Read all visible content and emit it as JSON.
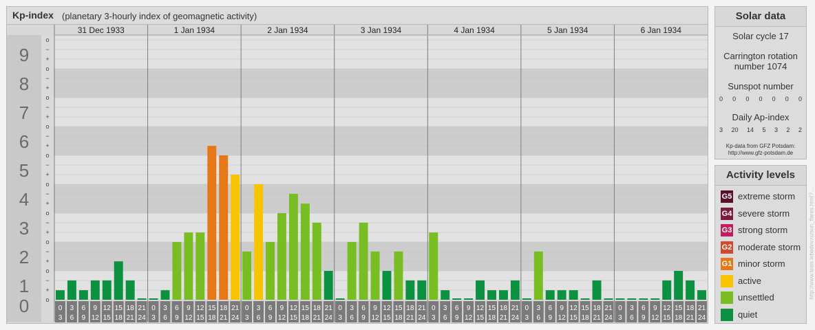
{
  "header": {
    "title": "Kp-index",
    "subtitle": "(planetary 3-hourly index of geomagnetic activity)"
  },
  "chart_data": {
    "type": "bar",
    "y_ticks": [
      "0",
      "1",
      "2",
      "3",
      "4",
      "5",
      "6",
      "7",
      "8",
      "9"
    ],
    "minor_labels": [
      "o",
      "+",
      "−",
      "o",
      "+",
      "−",
      "o",
      "+",
      "−",
      "o",
      "+",
      "−",
      "o",
      "+",
      "−",
      "o",
      "+",
      "−",
      "o",
      "+",
      "−",
      "o",
      "+",
      "−",
      "o",
      "+",
      "−",
      "o"
    ],
    "days": [
      "31 Dec 1933",
      "1 Jan 1934",
      "2 Jan 1934",
      "3 Jan 1934",
      "4 Jan 1934",
      "5 Jan 1934",
      "6 Jan 1934"
    ],
    "intervals": [
      [
        "0",
        "3"
      ],
      [
        "3",
        "6"
      ],
      [
        "6",
        "9"
      ],
      [
        "9",
        "12"
      ],
      [
        "12",
        "15"
      ],
      [
        "15",
        "18"
      ],
      [
        "18",
        "21"
      ],
      [
        "21",
        "24"
      ]
    ],
    "ylim": [
      0,
      9.33
    ],
    "values": [
      0.33,
      0.67,
      0.33,
      0.67,
      0.67,
      1.33,
      0.67,
      0,
      0,
      0.33,
      2,
      2.33,
      2.33,
      5.33,
      5,
      4.33,
      1.67,
      4,
      2,
      3,
      3.67,
      3.33,
      2.67,
      1,
      0,
      2,
      2.67,
      1.67,
      1,
      1.67,
      0.67,
      0.67,
      2.33,
      0.33,
      0,
      0,
      0.67,
      0.33,
      0.33,
      0.67,
      0,
      1.67,
      0.33,
      0.33,
      0.33,
      0,
      0.67,
      0,
      0,
      0,
      0,
      0,
      0.67,
      1,
      0.67,
      0.33
    ],
    "colors": {
      "quiet": "#0b9140",
      "unsettled": "#78be22",
      "active": "#f8c300",
      "minor": "#e67817",
      "moderate": "#d24a2c",
      "strong": "#bf1f5c",
      "severe": "#7b1c3f",
      "extreme": "#5a0f2a"
    }
  },
  "solar": {
    "title": "Solar data",
    "cycle": "Solar cycle 17",
    "carrington_1": "Carrington rotation",
    "carrington_2": "number 1074",
    "sunspot_label": "Sunspot number",
    "sunspots": [
      "0",
      "0",
      "0",
      "0",
      "0",
      "0",
      "0"
    ],
    "ap_label": "Daily Ap-index",
    "ap": [
      "3",
      "20",
      "14",
      "5",
      "3",
      "2",
      "2"
    ],
    "credit_1": "Kp-data from GFZ Potsdam:",
    "credit_2": "http://www.gfz-potsdam.de"
  },
  "activity": {
    "title": "Activity levels",
    "levels": [
      {
        "code": "G5",
        "label": "extreme storm",
        "color": "#5a0f2a"
      },
      {
        "code": "G4",
        "label": "severe storm",
        "color": "#7b1c3f"
      },
      {
        "code": "G3",
        "label": "strong storm",
        "color": "#bf1f5c"
      },
      {
        "code": "G2",
        "label": "moderate storm",
        "color": "#d24a2c"
      },
      {
        "code": "G1",
        "label": "minor storm",
        "color": "#e67817"
      },
      {
        "code": "",
        "label": "active",
        "color": "#f8c300"
      },
      {
        "code": "",
        "label": "unsettled",
        "color": "#78be22"
      },
      {
        "code": "",
        "label": "quiet",
        "color": "#0b9140"
      }
    ]
  },
  "sidebar": {
    "url": "http://www.tesis.lebedev.ru/sun_flares.html?..."
  }
}
